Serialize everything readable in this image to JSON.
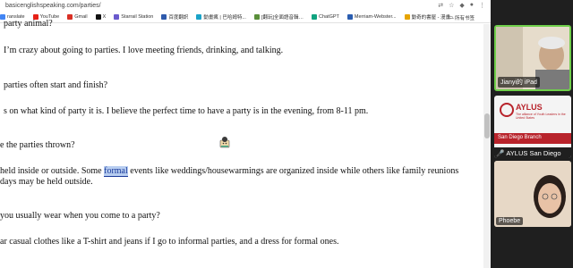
{
  "browser": {
    "url": "basicenglishspeaking.com/parties/",
    "bookmarks": [
      {
        "label": "ranslate",
        "color": "#4285f4"
      },
      {
        "label": "YouTube",
        "color": "#e62117"
      },
      {
        "label": "Gmail",
        "color": "#d93025"
      },
      {
        "label": "X",
        "color": "#111111"
      },
      {
        "label": "Starrail Station",
        "color": "#6a5acd"
      },
      {
        "label": "百度翻訳",
        "color": "#2e5aac"
      },
      {
        "label": "動畫瘋 | 巴哈姆特...",
        "color": "#1aa3c8"
      },
      {
        "label": "[翻玩]全面語音輯…",
        "color": "#5a8f3a"
      },
      {
        "label": "ChatGPT",
        "color": "#10a37f"
      },
      {
        "label": "Merriam-Webster...",
        "color": "#2a5db0"
      },
      {
        "label": "動奇的書屋 - 漫畫...",
        "color": "#e6a400"
      }
    ],
    "bookmarks_right": "所有书签"
  },
  "article": {
    "line1": "party animal?",
    "line2": "I’m crazy about going to parties. I love meeting friends, drinking, and talking.",
    "line3": "parties often start and finish?",
    "line4": "s on what kind of party it is. I believe the perfect time to have a party is in the evening, from 8-11 pm.",
    "line5": "e the parties thrown?",
    "line6_pre": "held inside or outside. Some ",
    "line6_hl": "formal",
    "line6_post": " events like weddings/housewarmings are organized inside while others like family reunions",
    "line7": "days may be held outside.",
    "line8": "you usually wear when you come to a party?",
    "line9": "ar casual clothes like a T-shirt and jeans if I go to informal parties, and a dress for formal ones."
  },
  "participants": {
    "p1": "Jianyi的 iPad",
    "p2": "AYLUS San Diego",
    "p3": "Phoebe",
    "aylus_title": "AYLUS",
    "aylus_sub": "The alliance of Youth Leaders in the United States",
    "aylus_branch": "San Diego Branch"
  }
}
